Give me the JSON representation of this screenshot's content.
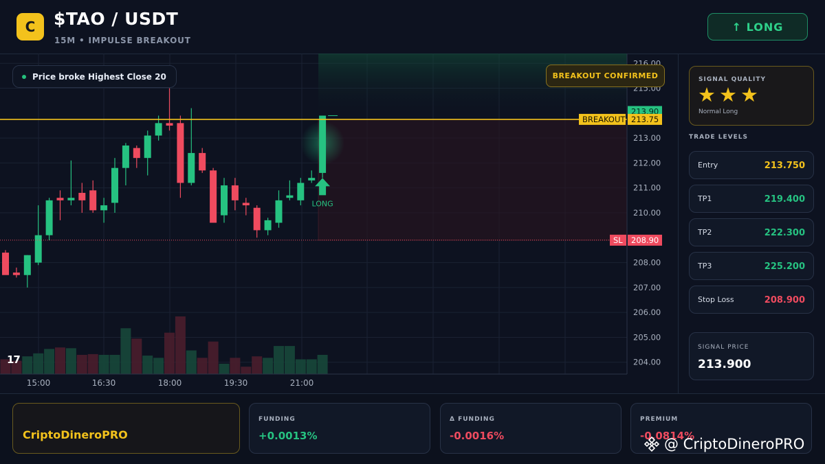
{
  "header": {
    "logo_letter": "C",
    "title": "$TAO / USDT",
    "subtitle": "15M • IMPULSE BREAKOUT",
    "direction_button": "↑ LONG"
  },
  "chart": {
    "info_text": "Price broke Highest Close 20",
    "confirmed_badge": "BREAKOUT CONFIRMED",
    "long_label": "LONG",
    "tv_logo": "17",
    "colors": {
      "up": "#26c281",
      "down": "#ef4b5f",
      "breakout": "#f3c21c"
    }
  },
  "chart_data": {
    "type": "candlestick",
    "x_tick_labels": [
      "15:00",
      "16:30",
      "18:00",
      "19:30",
      "21:00"
    ],
    "y_tick_labels": [
      "216.00",
      "215.00",
      "213.00",
      "212.00",
      "211.00",
      "210.00",
      "208.00",
      "207.00",
      "206.00",
      "205.00",
      "204.00"
    ],
    "ylim": [
      203.8,
      216.2
    ],
    "levels": [
      {
        "name": "BREAKOUT",
        "value": 213.75,
        "label": "213.75"
      },
      {
        "name": "SL",
        "value": 208.9,
        "label": "208.90"
      }
    ],
    "last_price": {
      "value": 213.9,
      "label": "213.90"
    },
    "candles": [
      {
        "o": 208.4,
        "h": 208.5,
        "l": 207.6,
        "c": 207.5
      },
      {
        "o": 207.6,
        "h": 207.8,
        "l": 207.4,
        "c": 207.5
      },
      {
        "o": 207.5,
        "h": 208.3,
        "l": 207.0,
        "c": 208.3
      },
      {
        "o": 208.0,
        "h": 210.3,
        "l": 207.9,
        "c": 209.1
      },
      {
        "o": 209.1,
        "h": 210.6,
        "l": 208.9,
        "c": 210.5
      },
      {
        "o": 210.6,
        "h": 210.9,
        "l": 209.7,
        "c": 210.5
      },
      {
        "o": 210.5,
        "h": 212.1,
        "l": 210.3,
        "c": 210.6
      },
      {
        "o": 210.8,
        "h": 211.2,
        "l": 210.0,
        "c": 210.5
      },
      {
        "o": 210.9,
        "h": 211.3,
        "l": 210.0,
        "c": 210.1
      },
      {
        "o": 210.1,
        "h": 210.6,
        "l": 209.6,
        "c": 210.3
      },
      {
        "o": 210.4,
        "h": 212.2,
        "l": 210.0,
        "c": 211.8
      },
      {
        "o": 211.8,
        "h": 212.8,
        "l": 211.1,
        "c": 212.7
      },
      {
        "o": 212.6,
        "h": 212.7,
        "l": 211.8,
        "c": 212.2
      },
      {
        "o": 212.2,
        "h": 213.3,
        "l": 211.5,
        "c": 213.1
      },
      {
        "o": 213.1,
        "h": 213.9,
        "l": 212.9,
        "c": 213.6
      },
      {
        "o": 213.6,
        "h": 215.0,
        "l": 213.3,
        "c": 213.5
      },
      {
        "o": 213.6,
        "h": 213.9,
        "l": 210.6,
        "c": 211.2
      },
      {
        "o": 211.2,
        "h": 214.2,
        "l": 211.1,
        "c": 212.4
      },
      {
        "o": 212.4,
        "h": 212.6,
        "l": 211.6,
        "c": 211.7
      },
      {
        "o": 211.7,
        "h": 211.8,
        "l": 209.6,
        "c": 209.6
      },
      {
        "o": 209.9,
        "h": 211.4,
        "l": 209.6,
        "c": 211.1
      },
      {
        "o": 211.1,
        "h": 211.4,
        "l": 210.1,
        "c": 210.5
      },
      {
        "o": 210.4,
        "h": 210.6,
        "l": 209.9,
        "c": 210.3
      },
      {
        "o": 210.2,
        "h": 210.3,
        "l": 209.0,
        "c": 209.3
      },
      {
        "o": 209.3,
        "h": 209.8,
        "l": 209.1,
        "c": 209.7
      },
      {
        "o": 209.6,
        "h": 210.9,
        "l": 209.4,
        "c": 210.5
      },
      {
        "o": 210.6,
        "h": 211.3,
        "l": 210.5,
        "c": 210.7
      },
      {
        "o": 210.5,
        "h": 211.4,
        "l": 210.3,
        "c": 211.2
      },
      {
        "o": 211.3,
        "h": 211.7,
        "l": 211.2,
        "c": 211.4
      },
      {
        "o": 211.6,
        "h": 213.9,
        "l": 211.4,
        "c": 213.9
      }
    ],
    "volume": [
      1.0,
      0.9,
      1.2,
      1.4,
      1.7,
      1.8,
      1.75,
      1.3,
      1.35,
      1.3,
      1.3,
      3.1,
      2.4,
      1.25,
      1.1,
      2.8,
      3.9,
      1.6,
      1.1,
      2.2,
      0.7,
      1.1,
      0.5,
      1.2,
      1.1,
      1.9,
      1.9,
      1.0,
      1.0,
      1.3
    ],
    "xlabel": "",
    "ylabel": ""
  },
  "signal_quality": {
    "label": "SIGNAL QUALITY",
    "stars": 3,
    "star_glyph": "★",
    "caption": "Normal Long"
  },
  "trade_levels": {
    "title": "TRADE LEVELS",
    "items": [
      {
        "name": "Entry",
        "value": "213.750",
        "color": "#f3c21c"
      },
      {
        "name": "TP1",
        "value": "219.400",
        "color": "#26c281"
      },
      {
        "name": "TP2",
        "value": "222.300",
        "color": "#26c281"
      },
      {
        "name": "TP3",
        "value": "225.200",
        "color": "#26c281"
      },
      {
        "name": "Stop Loss",
        "value": "208.900",
        "color": "#ef4b5f"
      }
    ]
  },
  "signal_price": {
    "label": "SIGNAL PRICE",
    "value": "213.900"
  },
  "footer": {
    "brand": "CriptoDineroPRO",
    "funding": {
      "label": "FUNDING",
      "value": "+0.0013%",
      "color": "#26c281"
    },
    "delta_funding": {
      "label": "Δ FUNDING",
      "value": "-0.0016%",
      "color": "#ef4b5f"
    },
    "premium": {
      "label": "PREMIUM",
      "value": "-0.0814%",
      "color": "#ef4b5f"
    },
    "watermark": "@ CriptoDineroPRO"
  }
}
